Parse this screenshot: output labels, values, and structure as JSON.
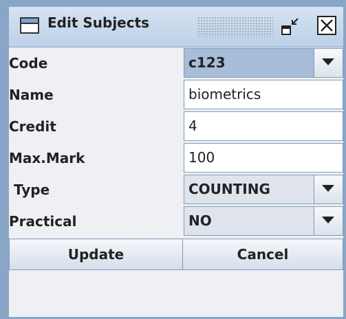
{
  "window": {
    "title": "Edit Subjects"
  },
  "form": {
    "code": {
      "label": "Code",
      "value": "c123"
    },
    "name": {
      "label": "Name",
      "value": "biometrics"
    },
    "credit": {
      "label": "Credit",
      "value": "4"
    },
    "max_mark": {
      "label": "Max.Mark",
      "value": "100"
    },
    "type": {
      "label": " Type",
      "value": "COUNTING"
    },
    "practical": {
      "label": "Practical",
      "value": "NO"
    }
  },
  "buttons": {
    "update": "Update",
    "cancel": "Cancel"
  },
  "icons": {
    "window": "window-icon",
    "minimize": "iconify-icon",
    "close": "close-icon",
    "dropdown": "chevron-down-icon"
  },
  "colors": {
    "frame": "#8aa6c7",
    "selected_combo": "#a8bdd8",
    "background": "#eef0f4"
  }
}
